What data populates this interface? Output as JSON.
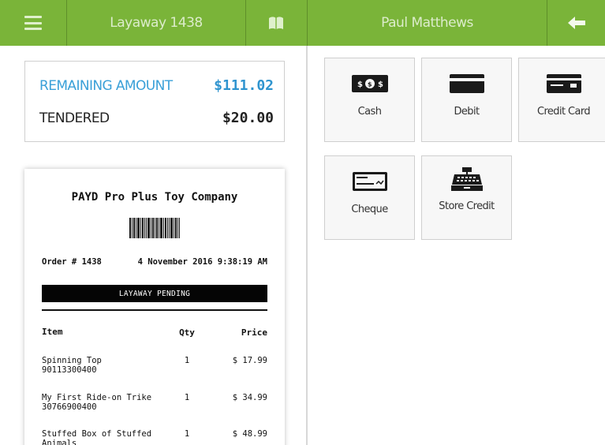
{
  "header": {
    "title": "Layaway 1438",
    "customer": "Paul Matthews"
  },
  "icons": {
    "menu": "hamburger-menu-icon",
    "book": "book-icon",
    "back": "arrow-left-icon",
    "cash": "cash-icon",
    "debit": "debit-card-icon",
    "credit": "credit-card-icon",
    "cheque": "cheque-icon",
    "store_credit": "cash-register-icon"
  },
  "colors": {
    "brand_green": "#7ab439",
    "remaining_blue": "#2f94cf"
  },
  "summary": {
    "remaining_label": "REMAINING AMOUNT",
    "remaining_value": "$111.02",
    "tendered_label": "TENDERED",
    "tendered_value": "$20.00"
  },
  "receipt": {
    "store_name": "PAYD Pro Plus Toy Company",
    "order_label": "Order # 1438",
    "datetime": "4 November 2016 9:38:19 AM",
    "status": "LAYAWAY PENDING",
    "columns": {
      "item": "Item",
      "qty": "Qty",
      "price": "Price"
    },
    "items": [
      {
        "name": "Spinning Top",
        "sku": "90113300400",
        "qty": "1",
        "price": "$ 17.99"
      },
      {
        "name": "My First Ride-on Trike",
        "sku": "30766900400",
        "qty": "1",
        "price": "$ 34.99"
      },
      {
        "name": "Stuffed Box of Stuffed",
        "sku": "Animals",
        "qty": "1",
        "price": "$ 48.99"
      }
    ]
  },
  "payment_methods": [
    {
      "label": "Cash"
    },
    {
      "label": "Debit"
    },
    {
      "label": "Credit Card"
    },
    {
      "label": "Cheque"
    },
    {
      "label": "Store Credit"
    }
  ]
}
